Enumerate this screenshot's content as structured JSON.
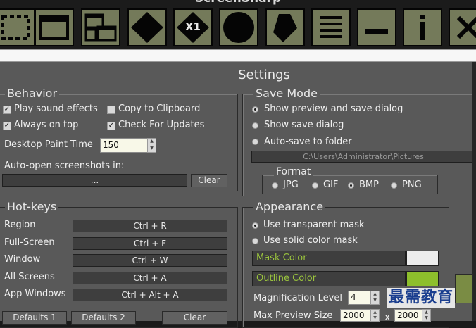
{
  "app_title": "ScreenSharp",
  "toolbar": {
    "tools": [
      {
        "name": "region-tool",
        "icon": "dashed-square-icon"
      },
      {
        "name": "window-tool",
        "icon": "window-icon"
      },
      {
        "name": "screens-tool",
        "icon": "multi-window-icon"
      },
      {
        "name": "octagon-tool",
        "icon": "octagon-icon"
      },
      {
        "name": "magnify-tool",
        "icon": "x1-octagon-icon",
        "label": "X1"
      },
      {
        "name": "ellipse-tool",
        "icon": "circle-icon"
      },
      {
        "name": "polygon-tool",
        "icon": "polygon-icon"
      },
      {
        "name": "list-tool",
        "icon": "lines-icon"
      },
      {
        "name": "minimize-tool",
        "icon": "dash-icon"
      },
      {
        "name": "info-tool",
        "icon": "info-icon"
      },
      {
        "name": "close-tool",
        "icon": "close-icon"
      }
    ]
  },
  "dialog": {
    "title": "Settings",
    "behavior": {
      "legend": "Behavior",
      "play_sound": "Play sound effects",
      "copy_clipboard": "Copy to Clipboard",
      "always_on_top": "Always on top",
      "check_updates": "Check For Updates",
      "paint_time_label": "Desktop Paint Time",
      "paint_time_value": "150",
      "auto_open_label": "Auto-open screenshots in:",
      "auto_open_value": "...",
      "clear": "Clear"
    },
    "save_mode": {
      "legend": "Save Mode",
      "opt_preview": "Show preview and save dialog",
      "opt_save_dialog": "Show save dialog",
      "opt_auto_save": "Auto-save to folder",
      "folder_path": "C:\\Users\\Administrator\\Pictures",
      "format": {
        "legend": "Format",
        "options": [
          "JPG",
          "GIF",
          "BMP",
          "PNG"
        ],
        "selected": "BMP"
      }
    },
    "hotkeys": {
      "legend": "Hot-keys",
      "rows": [
        {
          "label": "Region",
          "key": "Ctrl + R"
        },
        {
          "label": "Full-Screen",
          "key": "Ctrl + F"
        },
        {
          "label": "Window",
          "key": "Ctrl + W"
        },
        {
          "label": "All Screens",
          "key": "Ctrl + A"
        },
        {
          "label": "App Windows",
          "key": "Ctrl + Alt + A"
        }
      ],
      "defaults1": "Defaults 1",
      "defaults2": "Defaults 2",
      "clear": "Clear"
    },
    "appearance": {
      "legend": "Appearance",
      "opt_transparent": "Use transparent mask",
      "opt_solid": "Use solid color mask",
      "mask_color_label": "Mask Color",
      "mask_color": "#ededed",
      "outline_color_label": "Outline Color",
      "outline_color": "#8dbf2c",
      "magnification_label": "Magnification Level",
      "magnification_value": "4",
      "max_preview_label": "Max Preview Size",
      "max_preview_w": "2000",
      "max_preview_x": "x",
      "max_preview_h": "2000"
    }
  },
  "watermark": "最需教育"
}
